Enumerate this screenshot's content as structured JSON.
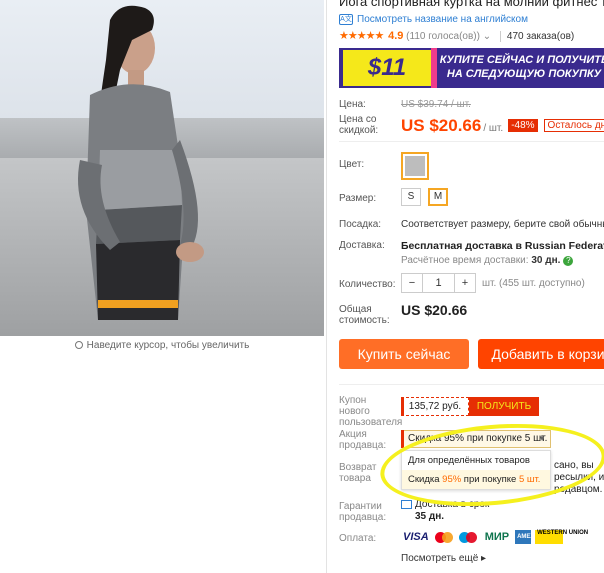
{
  "product": {
    "title": "Йога спортивная куртка на молнии фитнес трена",
    "english_link": "Посмотреть название на английском",
    "stars": "★★★★★",
    "rating": "4.9",
    "votes": "(110 голоса(ов))",
    "orders": "470 заказа(ов)"
  },
  "image": {
    "zoom_hint": "Наведите курсор, чтобы увеличить"
  },
  "banner": {
    "amount": "$11",
    "text_line1": "КУПИТЕ СЕЙЧАС И ПОЛУЧИТЕ",
    "text_line2": "НА СЛЕДУЮЩУЮ ПОКУПКУ"
  },
  "price": {
    "label": "Цена:",
    "old": "US $39.74 / шт.",
    "discount_label": "Цена со скидкой:",
    "current": "US $20.66",
    "unit": "/ шт.",
    "discount_badge": "-48%",
    "left_time": "Осталось дне"
  },
  "options": {
    "color_label": "Цвет:",
    "color_value": "#bdbdbd",
    "size_label": "Размер:",
    "sizes": [
      "S",
      "M"
    ],
    "selected_size": "M",
    "fit_label": "Посадка:",
    "fit_text": "Соответствует размеру, берите свой обычный р"
  },
  "shipping": {
    "label": "Доставка:",
    "text": "Бесплатная доставка в Russian Federation сл",
    "time_label": "Расчётное время доставки:",
    "time_value": "30 дн."
  },
  "quantity": {
    "label": "Количество:",
    "minus": "−",
    "value": "1",
    "plus": "+",
    "available": "шт. (455 шт. доступно)"
  },
  "total": {
    "label": "Общая стоимость:",
    "value": "US $20.66"
  },
  "actions": {
    "buy_now": "Купить сейчас",
    "add_to_cart": "Добавить в корзи"
  },
  "coupon": {
    "label": "Купон нового пользователя",
    "amount": "135,72 руб.",
    "get": "ПОЛУЧИТЬ"
  },
  "promo": {
    "label": "Акция продавца:",
    "selected": "Скидка 95% при покупке 5 шт.",
    "caret": "▼",
    "options": [
      {
        "text": "Для определённых товаров"
      },
      {
        "prefix": "Скидка ",
        "pct": "95%",
        "mid": " при покупке ",
        "qty": "5 шт."
      }
    ]
  },
  "returns": {
    "label": "Возврат товара",
    "line1": "сано, вы",
    "line2": "ресылки, и",
    "line3": "родавцом."
  },
  "guarantee": {
    "label": "Гарантии продавца:",
    "text": "Доставка в срок",
    "days": "35 дн."
  },
  "payment": {
    "label": "Оплата:",
    "methods": [
      "VISA",
      "MasterCard",
      "Maestro",
      "МИР",
      "AMEX",
      "WESTERN UNION"
    ],
    "see_more": "Посмотреть ещё ▸"
  },
  "colors": {
    "accent_orange": "#ff4400",
    "buy_now": "#ff6e26",
    "link_blue": "#2e7fd3",
    "highlight_yellow": "#f5f01e"
  }
}
